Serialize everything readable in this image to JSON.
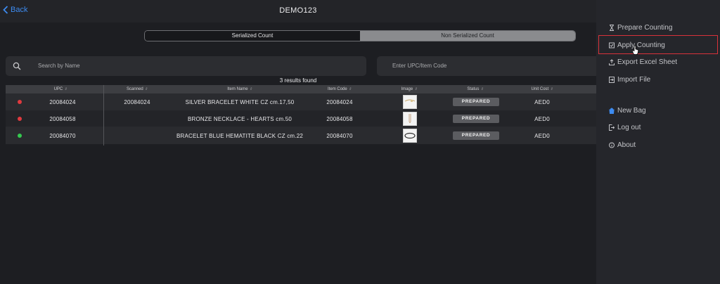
{
  "header": {
    "back_label": "Back",
    "title": "DEMO123"
  },
  "segments": {
    "serialized": "Serialized Count",
    "non_serialized": "Non Serialized Count"
  },
  "search": {
    "name_placeholder": "Search by Name",
    "upc_placeholder": "Enter UPC/Item Code"
  },
  "results_text": "3 results found",
  "table": {
    "headers": {
      "upc": "UPC",
      "scanned": "Scanned",
      "item_name": "Item Name",
      "item_code": "Item Code",
      "image": "Image",
      "status": "Status",
      "unit_cost": "Unit Cost"
    },
    "rows": [
      {
        "dot": "#e03a3f",
        "upc": "20084024",
        "scanned": "20084024",
        "item_name": "SILVER BRACELET WHITE CZ cm.17,50",
        "item_code": "20084024",
        "status": "PREPARED",
        "unit_cost": "AED0",
        "image_icon": "bracelet-photo-icon"
      },
      {
        "dot": "#e03a3f",
        "upc": "20084058",
        "scanned": "",
        "item_name": "BRONZE NECKLACE - HEARTS cm.50",
        "item_code": "20084058",
        "status": "PREPARED",
        "unit_cost": "AED0",
        "image_icon": "necklace-photo-icon"
      },
      {
        "dot": "#35c94f",
        "upc": "20084070",
        "scanned": "",
        "item_name": "BRACELET BLUE HEMATITE BLACK CZ cm.22",
        "item_code": "20084070",
        "status": "PREPARED",
        "unit_cost": "AED0",
        "image_icon": "bangle-photo-icon"
      }
    ]
  },
  "sidebar": {
    "items": [
      {
        "label": "Prepare Counting",
        "icon": "hourglass-icon"
      },
      {
        "label": "Apply Counting",
        "icon": "checkbox-icon"
      },
      {
        "label": "Export Excel Sheet",
        "icon": "upload-icon"
      },
      {
        "label": "Import File",
        "icon": "import-icon"
      },
      {
        "label": "New Bag",
        "icon": "bag-icon"
      },
      {
        "label": "Log out",
        "icon": "logout-icon"
      },
      {
        "label": "About",
        "icon": "info-icon"
      }
    ]
  },
  "colors": {
    "accent": "#3d8bf0",
    "highlight": "#d8323a",
    "status_red": "#e03a3f",
    "status_green": "#35c94f"
  }
}
